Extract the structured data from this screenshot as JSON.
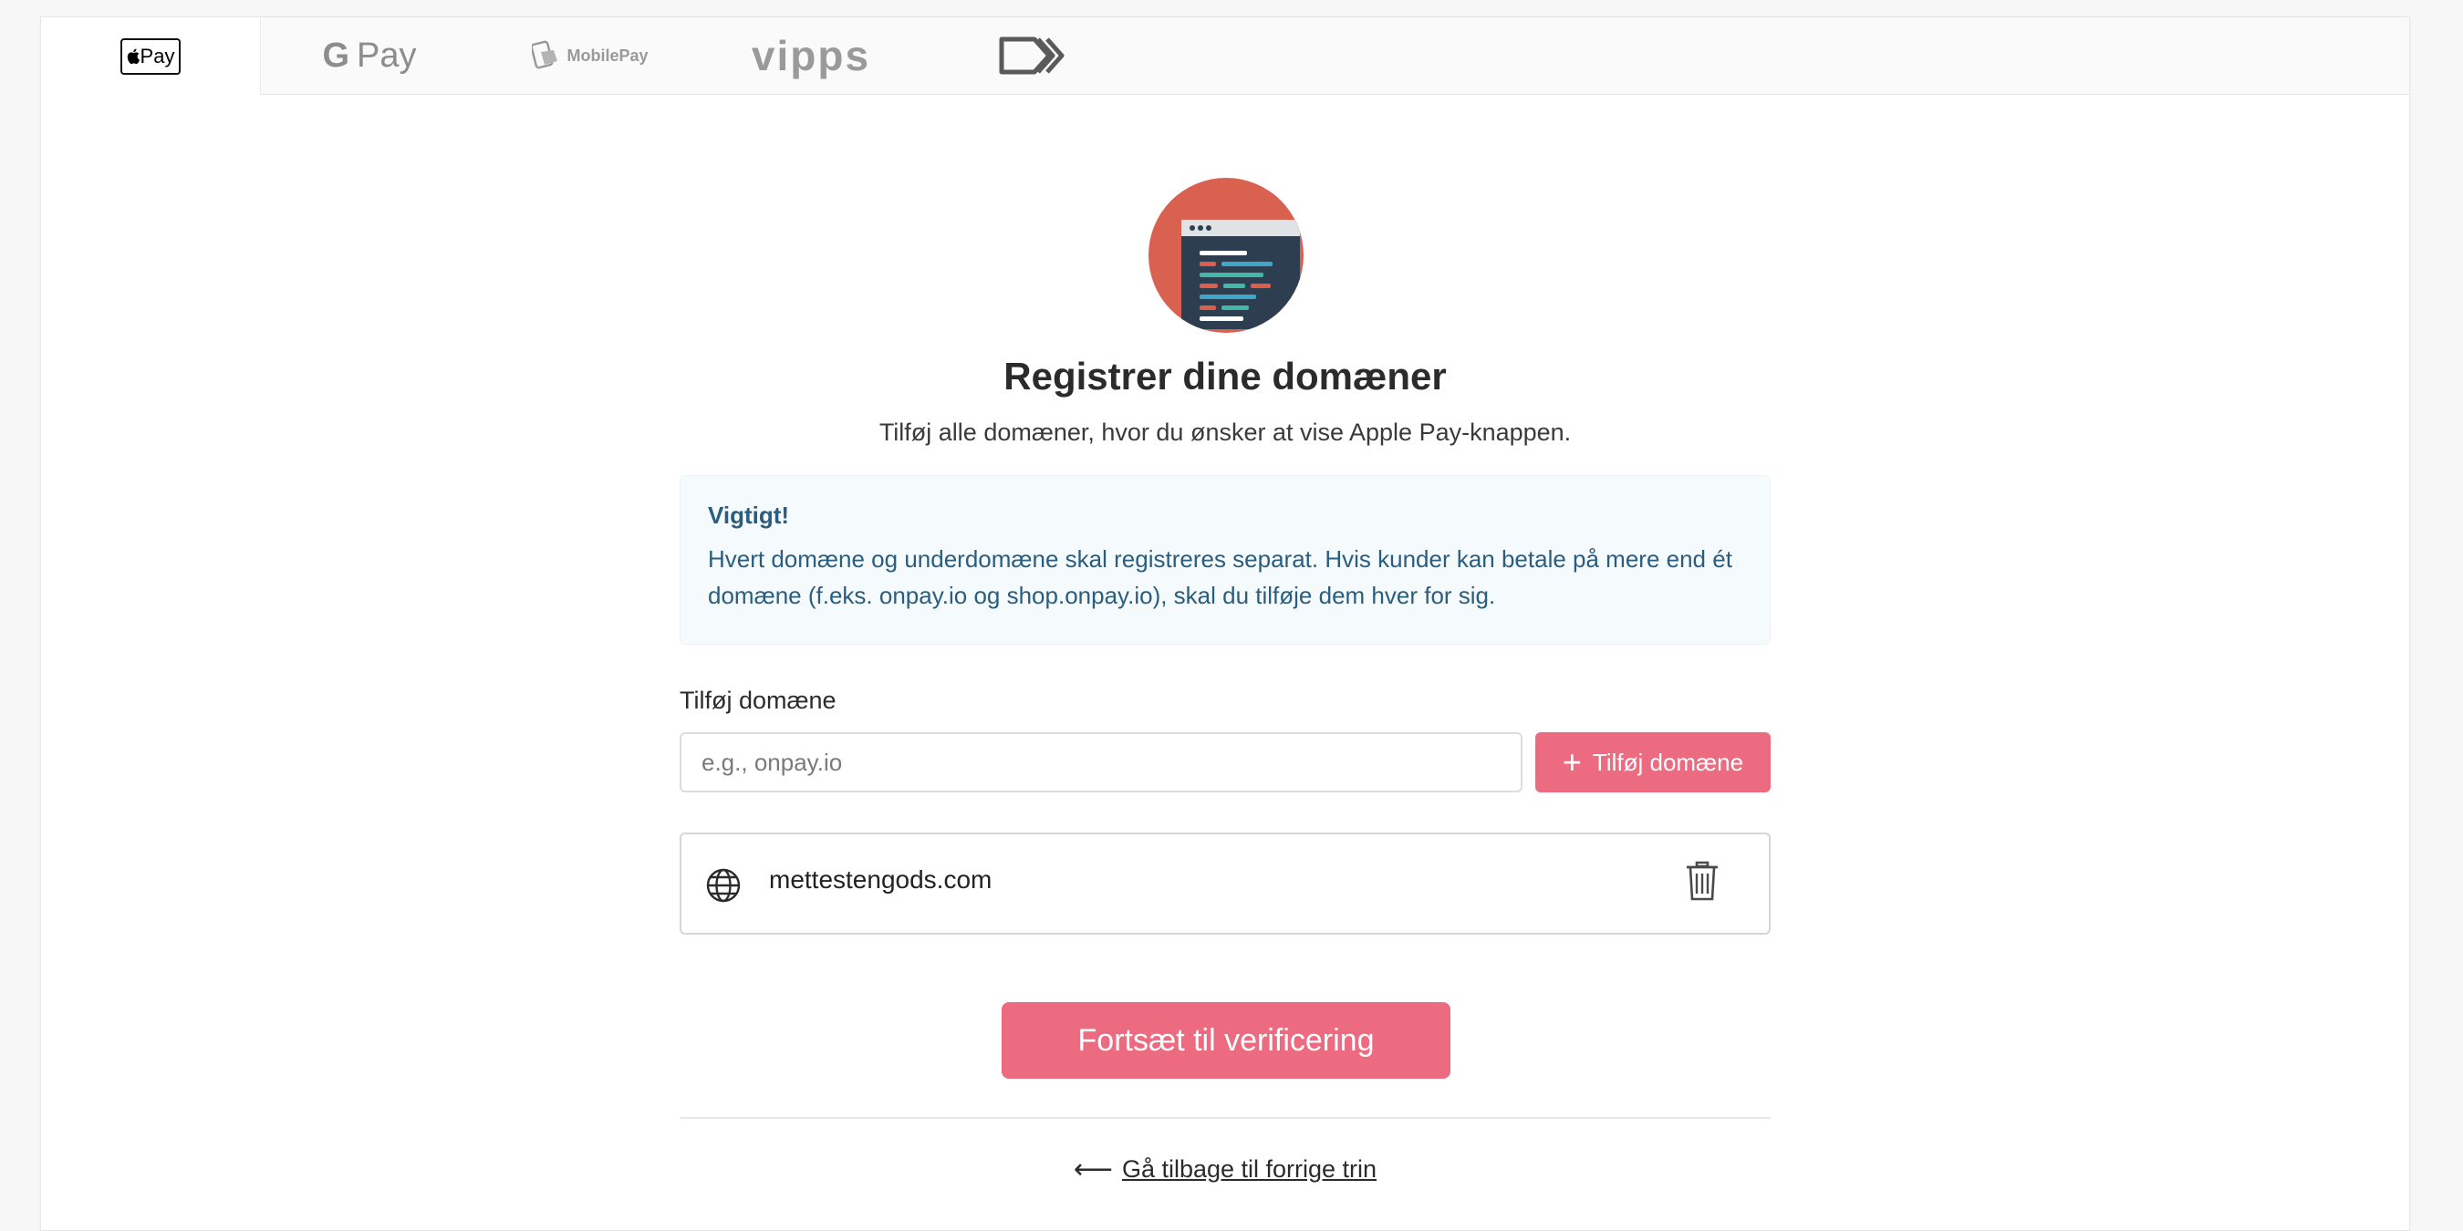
{
  "tabs": [
    {
      "id": "apple-pay",
      "label": "Pay",
      "icon": "apple-icon",
      "active": true
    },
    {
      "id": "google-pay",
      "label": "Pay",
      "brand_letter": "G",
      "active": false
    },
    {
      "id": "mobilepay",
      "label": "MobilePay",
      "active": false
    },
    {
      "id": "vipps",
      "label": "vipps",
      "active": false
    },
    {
      "id": "other",
      "icon": "double-chevron-logo-icon",
      "active": false
    }
  ],
  "main": {
    "title": "Registrer dine domæner",
    "subtitle": "Tilføj alle domæner, hvor du ønsker at vise Apple Pay-knappen.",
    "notice": {
      "title": "Vigtigt!",
      "text": "Hvert domæne og underdomæne skal registreres separat. Hvis kunder kan betale på mere end ét domæne (f.eks. onpay.io og shop.onpay.io), skal du tilføje dem hver for sig."
    },
    "add_domain": {
      "label": "Tilføj domæne",
      "placeholder": "e.g., onpay.io",
      "value": "",
      "button_label": "Tilføj domæne"
    },
    "domains": [
      {
        "name": "mettestengods.com"
      }
    ],
    "continue_label": "Fortsæt til verificering",
    "back_label": "Gå tilbage til forrige trin"
  },
  "colors": {
    "accent": "#ec6b80",
    "notice_text": "#2a5d7f",
    "notice_bg": "#f5fafc",
    "hero_bg": "#d9614f"
  }
}
